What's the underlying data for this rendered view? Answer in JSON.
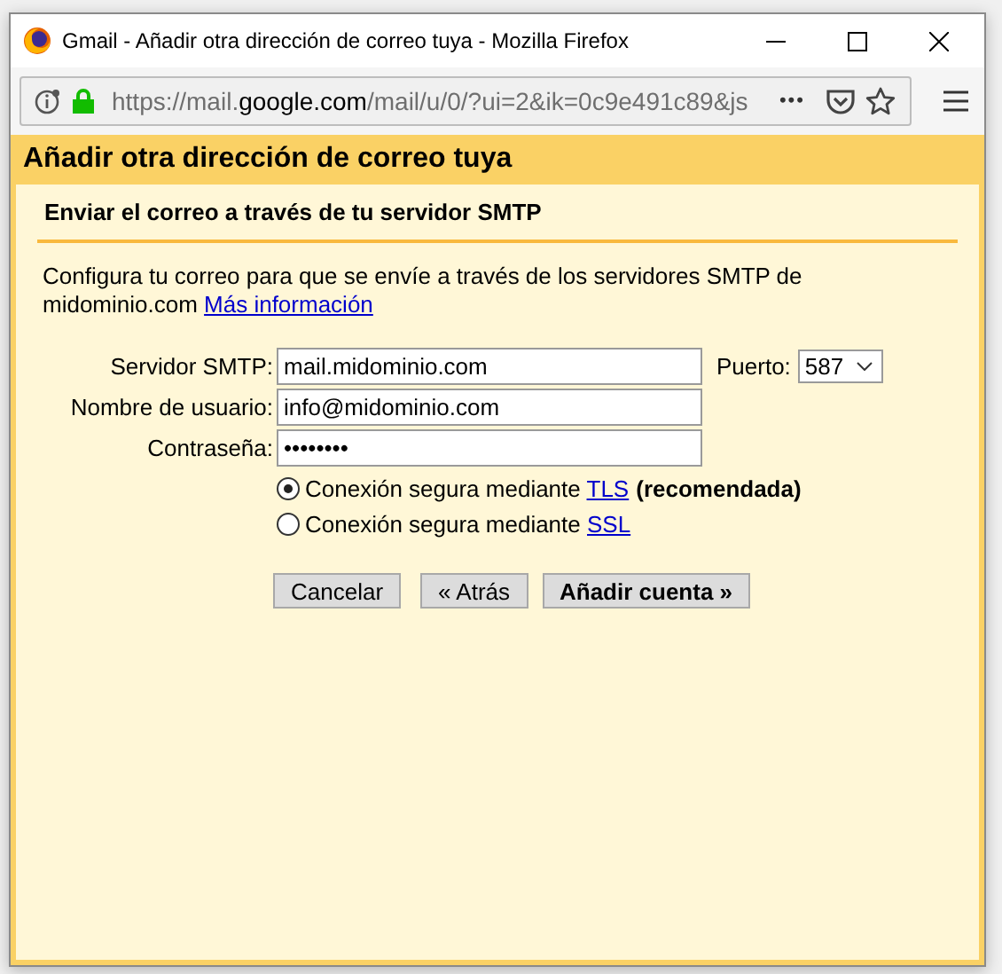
{
  "window": {
    "title": "Gmail - Añadir otra dirección de correo tuya - Mozilla Firefox"
  },
  "address_bar": {
    "url_prefix": "https://mail.",
    "url_domain": "google.com",
    "url_rest": "/mail/u/0/?ui=2&ik=0c9e491c89&js",
    "more": "•••"
  },
  "dialog": {
    "title": "Añadir otra dirección de correo tuya",
    "section_title": "Enviar el correo a través de tu servidor SMTP",
    "description": "Configura tu correo para que se envíe a través de los servidores SMTP de midominio.com",
    "description_link": "Más información"
  },
  "fields": [
    {
      "label": "Servidor SMTP:",
      "value": "mail.midominio.com"
    },
    {
      "label": "Nombre de usuario:",
      "value": "info@midominio.com"
    },
    {
      "label": "Contraseña:",
      "value": "••••••••"
    }
  ],
  "port": {
    "label": "Puerto:",
    "value": "587"
  },
  "security_options": [
    {
      "label": "Conexión segura mediante",
      "link": "TLS",
      "note": "(recomendada)",
      "selected": true
    },
    {
      "label": "Conexión segura mediante",
      "link": "SSL",
      "selected": false
    }
  ],
  "buttons": [
    {
      "label": "Cancelar",
      "kind": "default"
    },
    {
      "label": "« Atrás",
      "kind": "default"
    },
    {
      "label": "Añadir cuenta »",
      "kind": "primary"
    }
  ]
}
